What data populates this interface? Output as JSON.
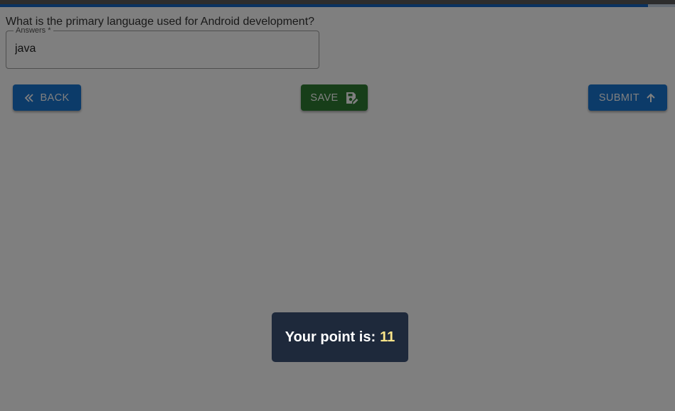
{
  "progress": {
    "fraction": 0.96,
    "color": "#1565c0"
  },
  "question": {
    "text": "What is the primary language used for Android development?"
  },
  "answer_field": {
    "label": "Answers *",
    "value": "java"
  },
  "buttons": {
    "back": {
      "label": "BACK",
      "icon": "double-chevron-left-icon",
      "color": "#1976d2"
    },
    "save": {
      "label": "SAVE",
      "icon": "save-edit-icon",
      "color": "#2e7d32"
    },
    "submit": {
      "label": "SUBMIT",
      "icon": "arrow-up-icon",
      "color": "#1976d2"
    }
  },
  "toast": {
    "label": "Your point is:",
    "value": "11",
    "value_color": "#fde68a"
  }
}
